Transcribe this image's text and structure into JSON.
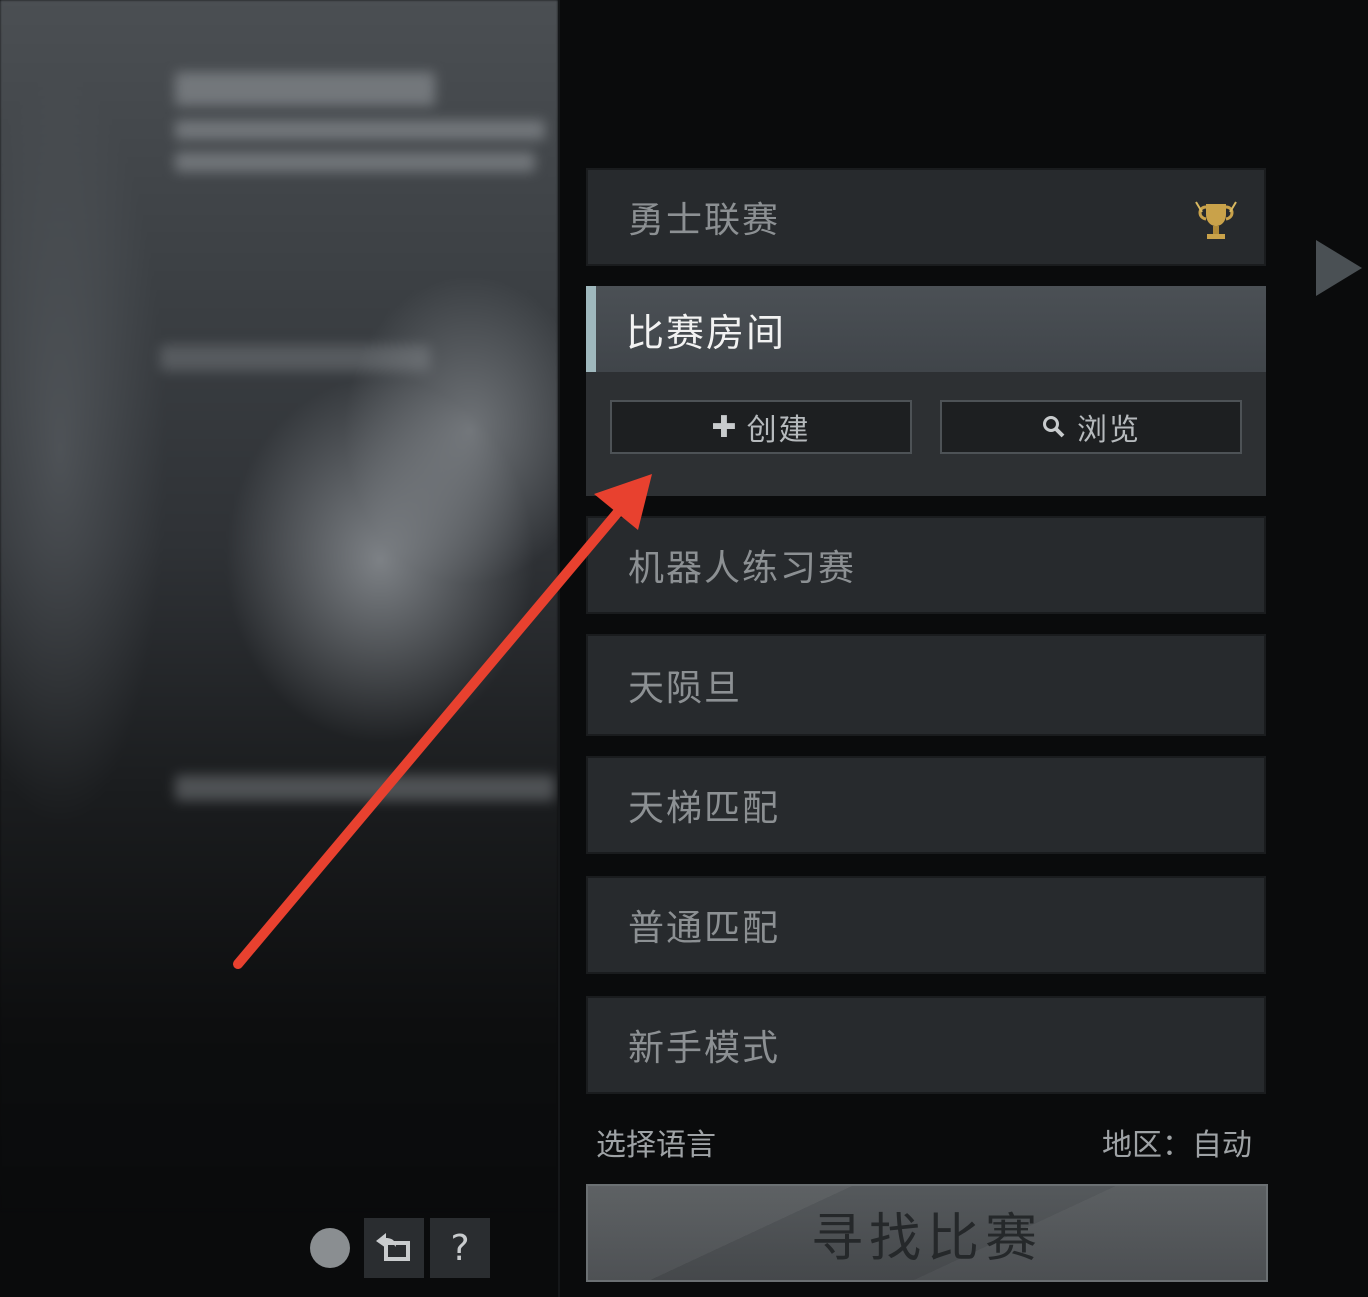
{
  "menu": {
    "items": [
      {
        "label": "勇士联赛",
        "icon": "trophy-icon"
      },
      {
        "label": "比赛房间",
        "active": true
      },
      {
        "label": "机器人练习赛"
      },
      {
        "label": "天陨旦"
      },
      {
        "label": "天梯匹配"
      },
      {
        "label": "普通匹配"
      },
      {
        "label": "新手模式"
      }
    ],
    "lobby_actions": {
      "create_label": "创建",
      "create_icon": "plus-icon",
      "browse_label": "浏览",
      "browse_icon": "search-icon"
    }
  },
  "footer": {
    "language_label": "选择语言",
    "region_label": "地区：自动"
  },
  "find_match_label": "寻找比赛",
  "bottom_bar": {
    "help_label": "?"
  },
  "colors": {
    "accent": "#9fb8bd",
    "annotation_arrow": "#e8412f",
    "trophy": "#c9a24a"
  }
}
